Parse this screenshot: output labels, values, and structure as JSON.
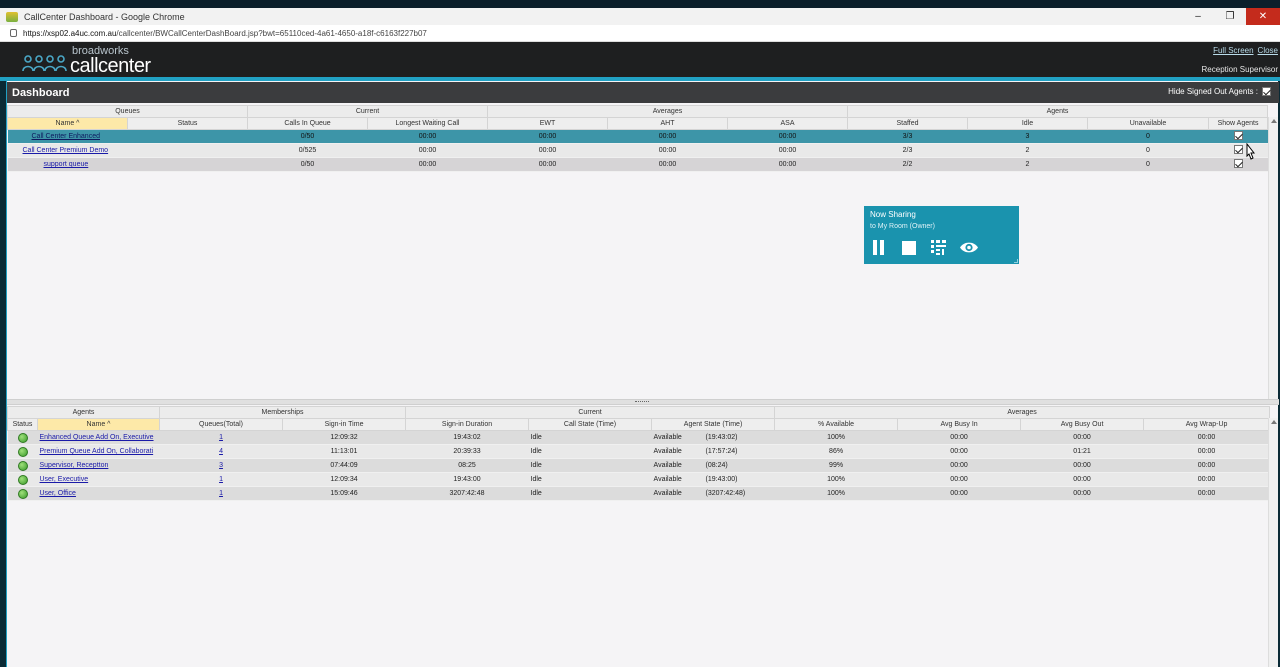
{
  "browser": {
    "window_title": "CallCenter Dashboard - Google Chrome",
    "url_host": "https://xsp02.a4uc.com.au",
    "url_path": "/callcenter/BWCallCenterDashBoard.jsp?bwt=65110ced-4a61-4650-a18f-c6163f227b07",
    "controls": {
      "minimize": "–",
      "restore": "❐",
      "close": "✕"
    }
  },
  "header": {
    "brand_small": "broadworks",
    "brand_big": "callcenter",
    "link_fullscreen": "Full Screen",
    "link_close": "Close",
    "user_label": "Reception Supervisor"
  },
  "dashboard": {
    "title": "Dashboard",
    "hide_signed_out_label": "Hide Signed Out Agents :",
    "hide_signed_out_checked": true
  },
  "queues": {
    "groups": [
      "Queues",
      "Current",
      "Averages",
      "Agents"
    ],
    "columns": [
      "Name ^",
      "Status",
      "Calls In Queue",
      "Longest Waiting Call",
      "EWT",
      "AHT",
      "ASA",
      "Staffed",
      "Idle",
      "Unavailable",
      "Show Agents"
    ],
    "rows": [
      {
        "name": "Call Center Enhanced",
        "status": "",
        "calls": "0/50",
        "longest": "00:00",
        "ewt": "00:00",
        "aht": "00:00",
        "asa": "00:00",
        "staffed": "3/3",
        "idle": "3",
        "unavailable": "0"
      },
      {
        "name": "Call Center Premium Demo",
        "status": "",
        "calls": "0/525",
        "longest": "00:00",
        "ewt": "00:00",
        "aht": "00:00",
        "asa": "00:00",
        "staffed": "2/3",
        "idle": "2",
        "unavailable": "0"
      },
      {
        "name": "support queue",
        "status": "",
        "calls": "0/50",
        "longest": "00:00",
        "ewt": "00:00",
        "aht": "00:00",
        "asa": "00:00",
        "staffed": "2/2",
        "idle": "2",
        "unavailable": "0"
      }
    ]
  },
  "agents": {
    "groups": [
      "Agents",
      "Memberships",
      "Current",
      "Averages"
    ],
    "columns": [
      "Status",
      "Name ^",
      "Queues(Total)",
      "Sign-in Time",
      "Sign-in Duration",
      "Call State (Time)",
      "Agent State (Time)",
      "% Available",
      "Avg Busy In",
      "Avg Busy Out",
      "Avg Wrap-Up"
    ],
    "rows": [
      {
        "name": "Enhanced Queue Add On, Executive",
        "queues": "1",
        "signin": "12:09:32",
        "duration": "19:43:02",
        "callstate": "Idle",
        "agentstate": "Available",
        "agenttime": "(19:43:02)",
        "available": "100%",
        "busyin": "00:00",
        "busyout": "00:00",
        "wrap": "00:00"
      },
      {
        "name": "Premium Queue Add On, Collaborati",
        "queues": "4",
        "signin": "11:13:01",
        "duration": "20:39:33",
        "callstate": "Idle",
        "agentstate": "Available",
        "agenttime": "(17:57:24)",
        "available": "86%",
        "busyin": "00:00",
        "busyout": "01:21",
        "wrap": "00:00"
      },
      {
        "name": "Supervisor, Receptton",
        "queues": "3",
        "signin": "07:44:09",
        "duration": "08:25",
        "callstate": "Idle",
        "agentstate": "Available",
        "agenttime": "(08:24)",
        "available": "99%",
        "busyin": "00:00",
        "busyout": "00:00",
        "wrap": "00:00"
      },
      {
        "name": "User, Executive",
        "queues": "1",
        "signin": "12:09:34",
        "duration": "19:43:00",
        "callstate": "Idle",
        "agentstate": "Available",
        "agenttime": "(19:43:00)",
        "available": "100%",
        "busyin": "00:00",
        "busyout": "00:00",
        "wrap": "00:00"
      },
      {
        "name": "User, Office",
        "queues": "1",
        "signin": "15:09:46",
        "duration": "3207:42:48",
        "callstate": "Idle",
        "agentstate": "Available",
        "agenttime": "(3207:42:48)",
        "available": "100%",
        "busyin": "00:00",
        "busyout": "00:00",
        "wrap": "00:00"
      }
    ]
  },
  "share_popup": {
    "title": "Now Sharing",
    "subtitle": "to My Room (Owner)",
    "icons": [
      "pause-icon",
      "stop-icon",
      "annotate-icon",
      "view-icon"
    ]
  },
  "colors": {
    "accent": "#21a1c3",
    "selected_row": "#3d95a8",
    "share_bg": "#1a93ae",
    "sorted_header": "#fde9a8"
  }
}
